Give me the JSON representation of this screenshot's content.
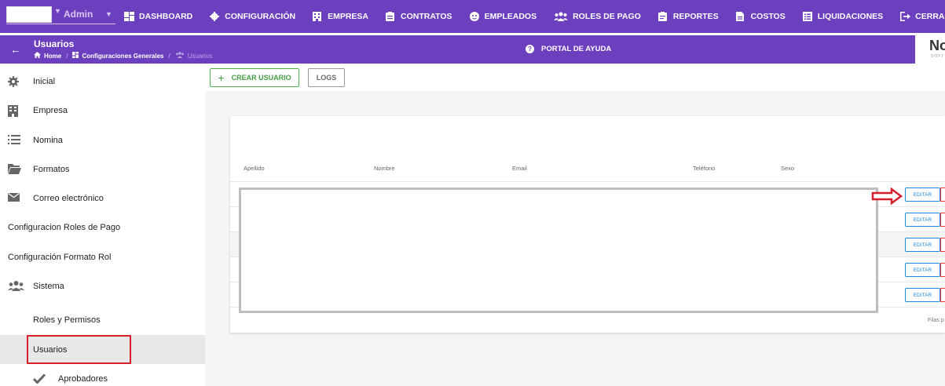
{
  "topbar": {
    "user_name": "Admin",
    "nav": [
      {
        "label": "DASHBOARD",
        "icon": "dashboard-icon"
      },
      {
        "label": "CONFIGURACIÓN",
        "icon": "gear-icon"
      },
      {
        "label": "EMPRESA",
        "icon": "building-icon"
      },
      {
        "label": "CONTRATOS",
        "icon": "clipboard-icon"
      },
      {
        "label": "EMPLEADOS",
        "icon": "face-icon"
      },
      {
        "label": "ROLES DE PAGO",
        "icon": "people-icon"
      },
      {
        "label": "REPORTES",
        "icon": "report-icon"
      },
      {
        "label": "COSTOS",
        "icon": "document-icon"
      },
      {
        "label": "LIQUIDACIONES",
        "icon": "list-icon"
      },
      {
        "label": "CERRAR SESIÓN",
        "icon": "logout-icon"
      }
    ],
    "colors": {
      "primary": "#6c3fbf"
    }
  },
  "subheader": {
    "title": "Usuarios",
    "breadcrumb": {
      "home": "Home",
      "section": "Configuraciones Generales",
      "current": "Usuarios"
    },
    "help_label": "PORTAL DE AYUDA",
    "logo_text": "No",
    "logo_sub": "SOFT"
  },
  "sidebar": {
    "items": [
      {
        "label": "Inicial",
        "icon": "gear-icon"
      },
      {
        "label": "Empresa",
        "icon": "building-icon"
      },
      {
        "label": "Nomina",
        "icon": "list-icon"
      },
      {
        "label": "Formatos",
        "icon": "folder-icon"
      },
      {
        "label": "Correo electrónico",
        "icon": "mail-icon"
      },
      {
        "label": "Configuracion Roles de Pago",
        "icon": ""
      },
      {
        "label": "Configuración Formato Rol",
        "icon": ""
      },
      {
        "label": "Sistema",
        "icon": "people-icon"
      },
      {
        "label": "Roles y Permisos",
        "icon": ""
      },
      {
        "label": "Usuarios",
        "icon": "",
        "active": true
      },
      {
        "label": "Aprobadores",
        "icon": "check-icon"
      }
    ]
  },
  "toolbar": {
    "create_label": "CREAR USUARIO",
    "logs_label": "LOGS"
  },
  "table": {
    "columns": [
      "Apellido",
      "Nombre",
      "Email",
      "Teléfono",
      "Sexo"
    ],
    "edit_label": "EDITAR",
    "row_count": 5,
    "footer": "Filas p"
  }
}
